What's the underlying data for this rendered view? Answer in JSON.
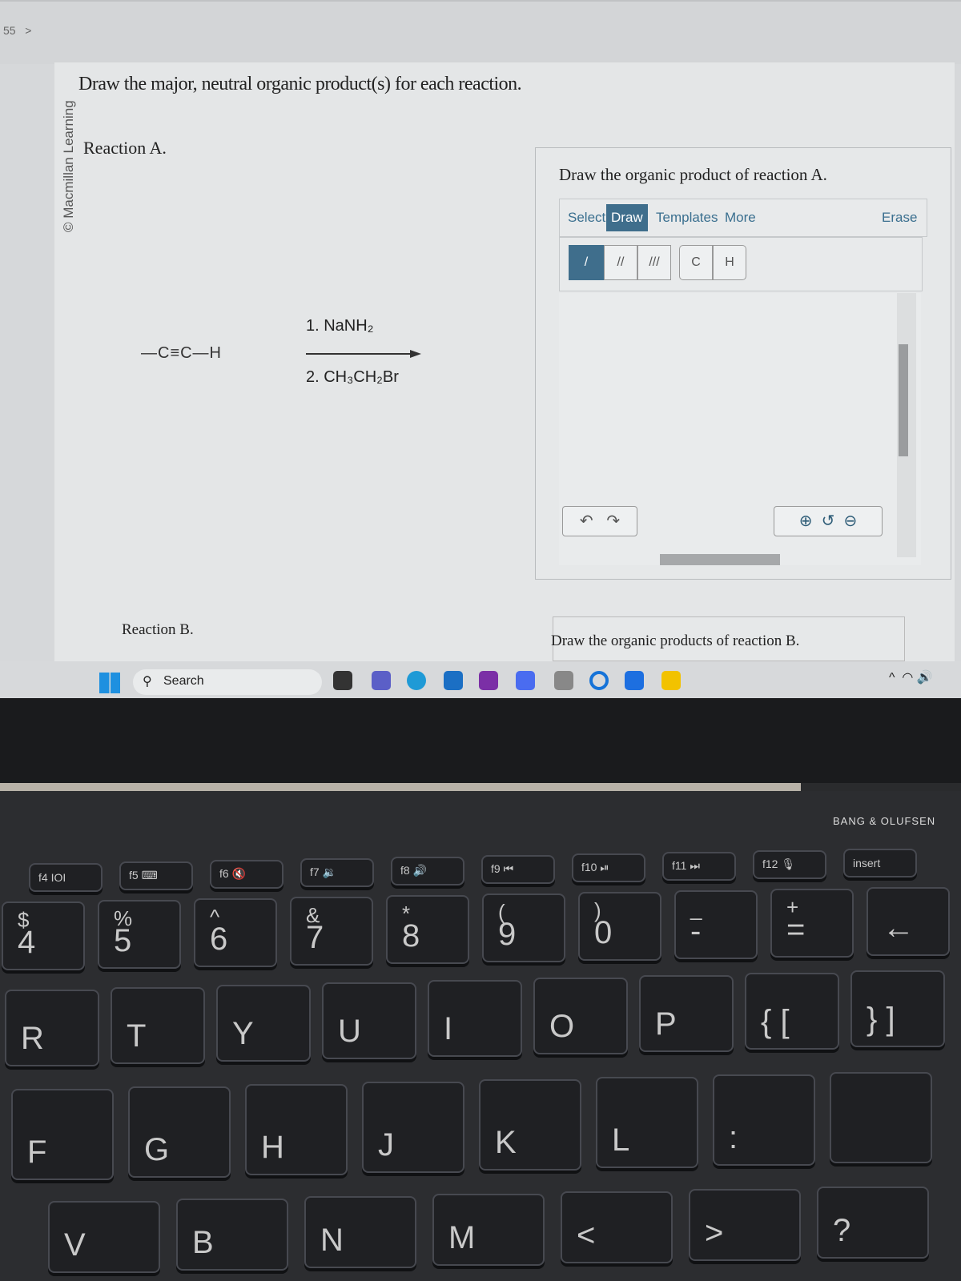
{
  "browser": {
    "nav_text": "55",
    "nav_chevron": ">"
  },
  "brand": "© Macmillan Learning",
  "question": "Draw the major, neutral organic product(s) for each reaction.",
  "reaction_a": {
    "label": "Reaction A.",
    "reactant": "—C≡C—H",
    "step1": "1. NaNH₂",
    "step2": "2. CH₃CH₂Br"
  },
  "reaction_b": {
    "label": "Reaction B."
  },
  "editor_a": {
    "title": "Draw the organic product of reaction A.",
    "tabs": [
      "Select",
      "Draw",
      "Templates",
      "More"
    ],
    "active_tab": "Draw",
    "erase": "Erase",
    "bonds": [
      "/",
      "//",
      "///"
    ],
    "atoms": [
      "C",
      "H"
    ],
    "icons": [
      "undo-icon",
      "redo-icon",
      "zoom-in-icon",
      "reset-zoom-icon",
      "zoom-out-icon"
    ]
  },
  "editor_b": {
    "title": "Draw the organic products of reaction B."
  },
  "taskbar": {
    "search": "Search",
    "tray": [
      "^",
      "wifi-icon",
      "speaker-icon"
    ]
  },
  "colors": {
    "accent": "#3f6e8c"
  },
  "laptop": {
    "brand": "BANG & OLUFSEN"
  },
  "keys": {
    "fn": [
      "f4 IOI",
      "f5 ⌨",
      "f6 🔇",
      "f7 🔉",
      "f8 🔊",
      "f9 ⏮",
      "f10 ⏯",
      "f11 ⏭",
      "f12 🎙",
      "insert"
    ],
    "num": [
      [
        "$",
        "4"
      ],
      [
        "%",
        "5"
      ],
      [
        "^",
        "6"
      ],
      [
        "&",
        "7"
      ],
      [
        "*",
        "8"
      ],
      [
        "(",
        "9"
      ],
      [
        ")",
        "0"
      ],
      [
        "_",
        "-"
      ],
      [
        "+",
        "="
      ],
      [
        "",
        "←"
      ]
    ],
    "top": [
      "R",
      "T",
      "Y",
      "U",
      "I",
      "O",
      "P",
      "{ [",
      "} ]"
    ],
    "home": [
      "F",
      "G",
      "H",
      "J",
      "K",
      "L",
      ":",
      ""
    ],
    "bottom": [
      "V",
      "B",
      "N",
      "M",
      "<",
      ">",
      "?"
    ]
  }
}
